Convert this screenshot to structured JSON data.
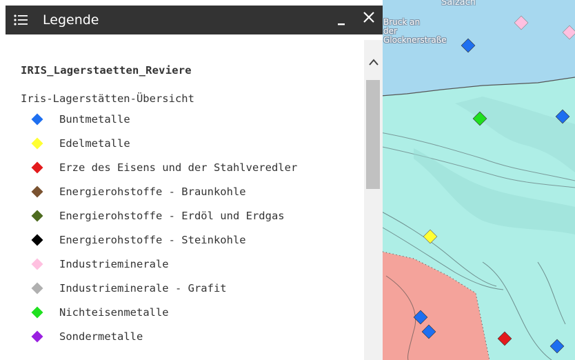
{
  "panel": {
    "title": "Legende",
    "layer_title": "IRIS_Lagerstaetten_Reviere",
    "sublayer_title": "Iris-Lagerstätten-Übersicht",
    "items": [
      {
        "label": "Buntmetalle",
        "color": "#1e6ff0"
      },
      {
        "label": "Edelmetalle",
        "color": "#ffff33"
      },
      {
        "label": "Erze des Eisens und der Stahlveredler",
        "color": "#e31a1c"
      },
      {
        "label": "Energierohstoffe - Braunkohle",
        "color": "#7a5230"
      },
      {
        "label": "Energierohstoffe - Erdöl und Erdgas",
        "color": "#4d6b1f"
      },
      {
        "label": "Energierohstoffe - Steinkohle",
        "color": "#000000"
      },
      {
        "label": "Industrieminerale",
        "color": "#ffc0e0"
      },
      {
        "label": "Industrieminerale - Grafit",
        "color": "#b0b0b0"
      },
      {
        "label": "Nichteisenmetalle",
        "color": "#1fe01f"
      },
      {
        "label": "Sondermetalle",
        "color": "#9a1fe0"
      }
    ]
  },
  "map": {
    "labels": {
      "river": "Salzach",
      "town": "Bruck an der Glocknerstraße"
    }
  }
}
